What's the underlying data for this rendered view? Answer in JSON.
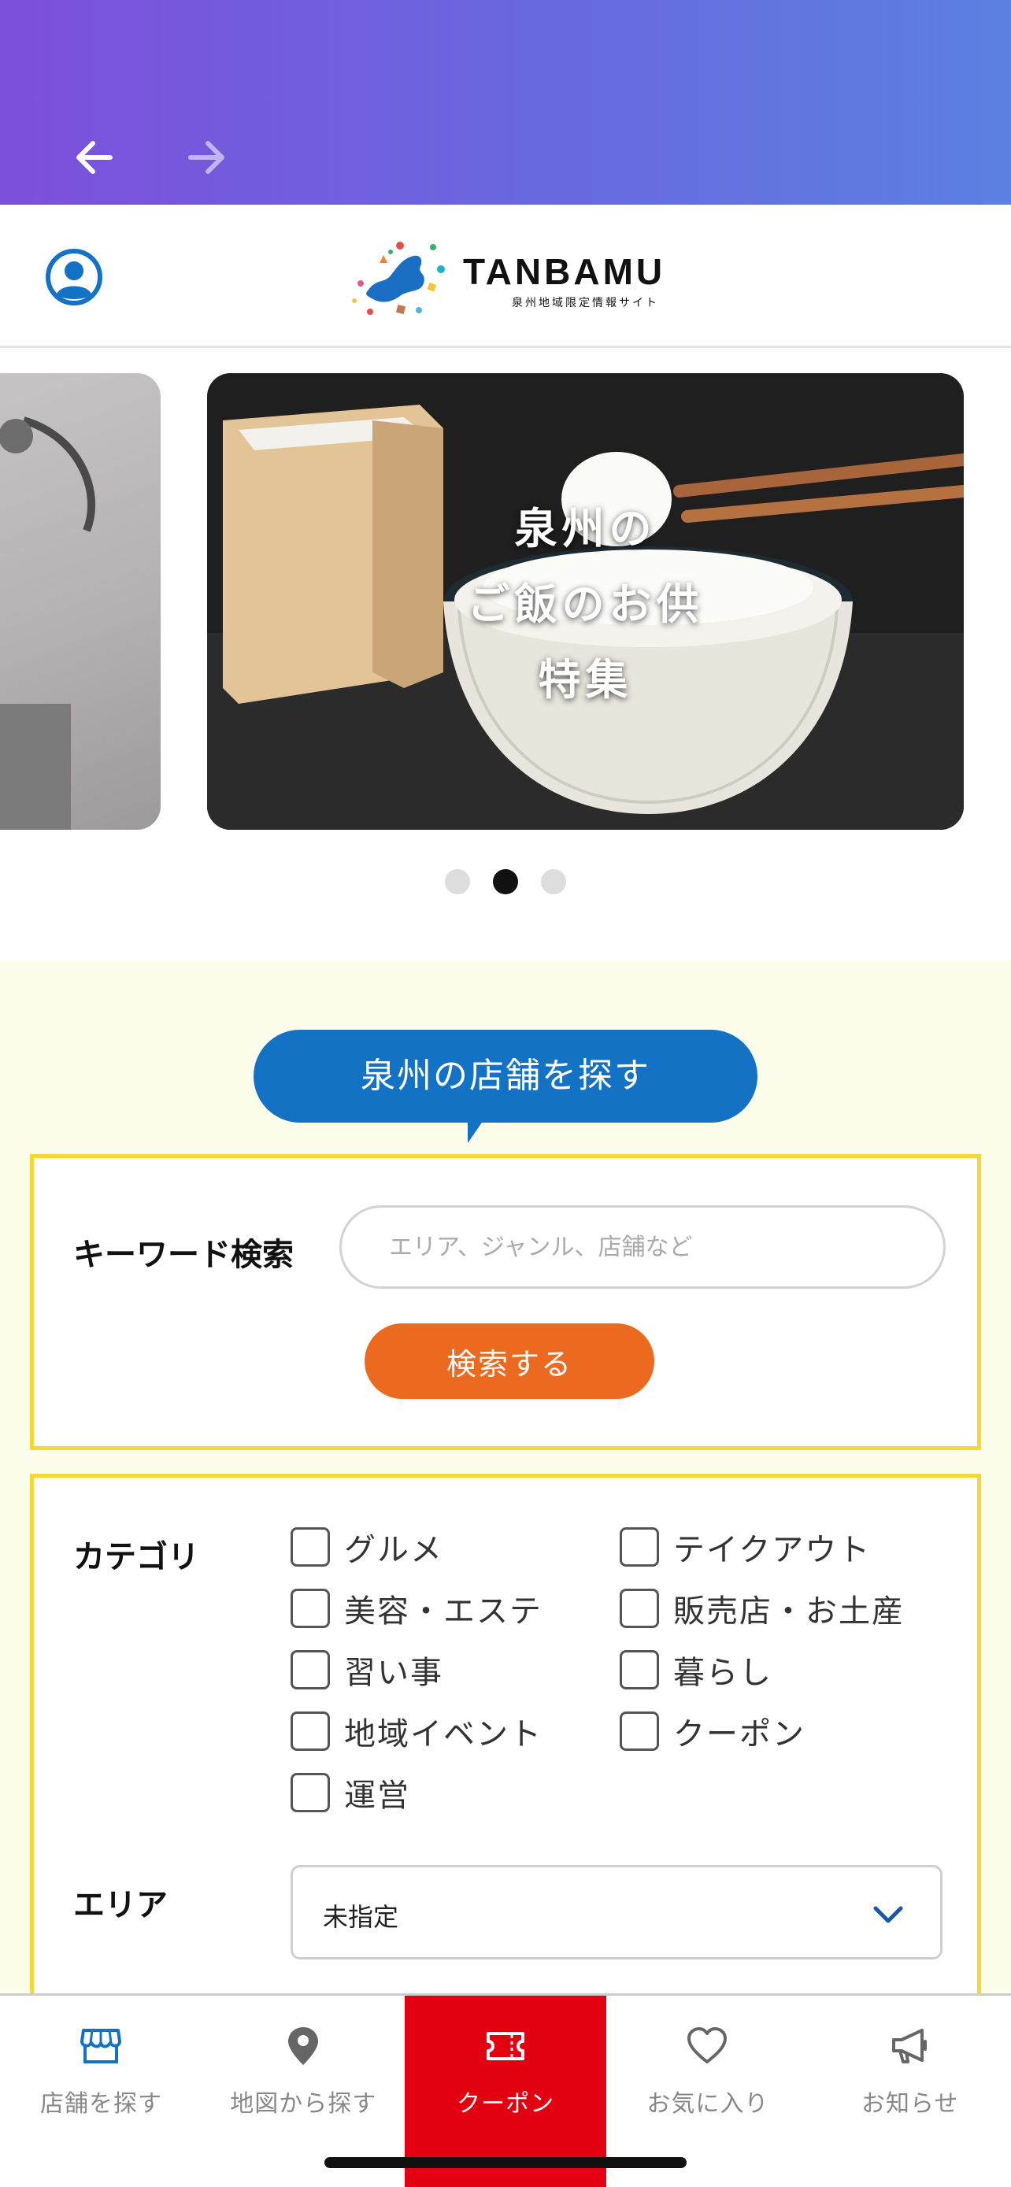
{
  "header": {
    "logo_text": "TANBAMU",
    "logo_subtitle": "泉州地域限定情報サイト"
  },
  "carousel": {
    "slide_title_lines": [
      "泉州の",
      "ご飯のお供",
      "特集"
    ],
    "dot_count": 3,
    "active_index": 1
  },
  "store_search": {
    "heading": "泉州の店舗を探す",
    "keyword_label": "キーワード検索",
    "keyword_placeholder": "エリア、ジャンル、店舗など",
    "keyword_value": "",
    "search_button": "検索する",
    "category_label": "カテゴリ",
    "categories": [
      {
        "label": "グルメ",
        "checked": false
      },
      {
        "label": "テイクアウト",
        "checked": false
      },
      {
        "label": "美容・エステ",
        "checked": false
      },
      {
        "label": "販売店・お土産",
        "checked": false
      },
      {
        "label": "習い事",
        "checked": false
      },
      {
        "label": "暮らし",
        "checked": false
      },
      {
        "label": "地域イベント",
        "checked": false
      },
      {
        "label": "クーポン",
        "checked": false
      },
      {
        "label": "運営",
        "checked": false
      }
    ],
    "area_label": "エリア",
    "area_value": "未指定"
  },
  "bottom_nav": [
    {
      "label": "店舗を探す",
      "icon": "store-icon",
      "active": false
    },
    {
      "label": "地図から探す",
      "icon": "map-pin-icon",
      "active": false
    },
    {
      "label": "クーポン",
      "icon": "coupon-icon",
      "active": true
    },
    {
      "label": "お気に入り",
      "icon": "heart-icon",
      "active": false
    },
    {
      "label": "お知らせ",
      "icon": "megaphone-icon",
      "active": false
    }
  ],
  "colors": {
    "gradient_start": "#7d4fdb",
    "gradient_end": "#5b80e2",
    "primary_blue": "#1372c4",
    "search_button": "#ec6a1f",
    "frame_yellow": "#f6d835",
    "section_bg": "#fcfdea",
    "nav_active": "#e30010"
  }
}
